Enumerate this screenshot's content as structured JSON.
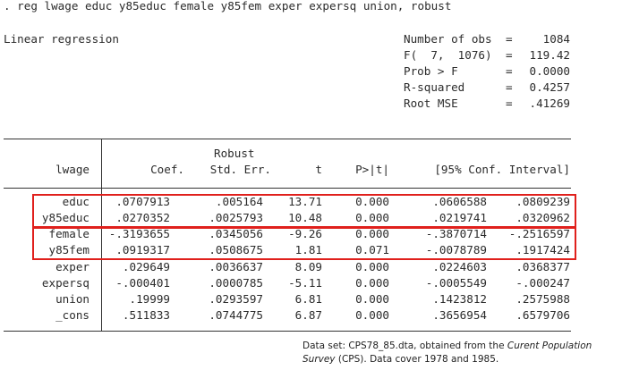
{
  "command": ". reg lwage educ y85educ female y85fem exper expersq union, robust",
  "model_title": "Linear regression",
  "stats": [
    {
      "label": "Number of obs",
      "eq": "=",
      "value": "1084"
    },
    {
      "label": "F(  7,  1076)",
      "eq": "=",
      "value": "119.42"
    },
    {
      "label": "Prob > F",
      "eq": "=",
      "value": "0.0000"
    },
    {
      "label": "R-squared",
      "eq": "=",
      "value": "0.4257"
    },
    {
      "label": "Root MSE",
      "eq": "=",
      "value": ".41269"
    }
  ],
  "table": {
    "header_top": "Robust",
    "headers": [
      "lwage",
      "Coef.",
      "Std. Err.",
      "t",
      "P>|t|",
      "[95% Conf. Interval]"
    ],
    "rows": [
      {
        "var": "educ",
        "coef": ".0707913",
        "se": ".005164",
        "t": "13.71",
        "p": "0.000",
        "lo": ".0606588",
        "hi": ".0809239"
      },
      {
        "var": "y85educ",
        "coef": ".0270352",
        "se": ".0025793",
        "t": "10.48",
        "p": "0.000",
        "lo": ".0219741",
        "hi": ".0320962"
      },
      {
        "var": "female",
        "coef": "-.3193655",
        "se": ".0345056",
        "t": "-9.26",
        "p": "0.000",
        "lo": "-.3870714",
        "hi": "-.2516597"
      },
      {
        "var": "y85fem",
        "coef": ".0919317",
        "se": ".0508675",
        "t": "1.81",
        "p": "0.071",
        "lo": "-.0078789",
        "hi": ".1917424"
      },
      {
        "var": "exper",
        "coef": ".029649",
        "se": ".0036637",
        "t": "8.09",
        "p": "0.000",
        "lo": ".0224603",
        "hi": ".0368377"
      },
      {
        "var": "expersq",
        "coef": "-.000401",
        "se": ".0000785",
        "t": "-5.11",
        "p": "0.000",
        "lo": "-.0005549",
        "hi": "-.000247"
      },
      {
        "var": "union",
        "coef": ".19999",
        "se": ".0293597",
        "t": "6.81",
        "p": "0.000",
        "lo": ".1423812",
        "hi": ".2575988"
      },
      {
        "var": "_cons",
        "coef": ".511833",
        "se": ".0744775",
        "t": "6.87",
        "p": "0.000",
        "lo": ".3656954",
        "hi": ".6579706"
      }
    ]
  },
  "caption": {
    "pre": "Data set: CPS78_85.dta, obtained from the ",
    "italic": "Curent Population Survey",
    "post": " (CPS). Data cover 1978 and 1985."
  },
  "colors": {
    "highlight_box": "#e0201c",
    "text": "#2b2b2b"
  }
}
